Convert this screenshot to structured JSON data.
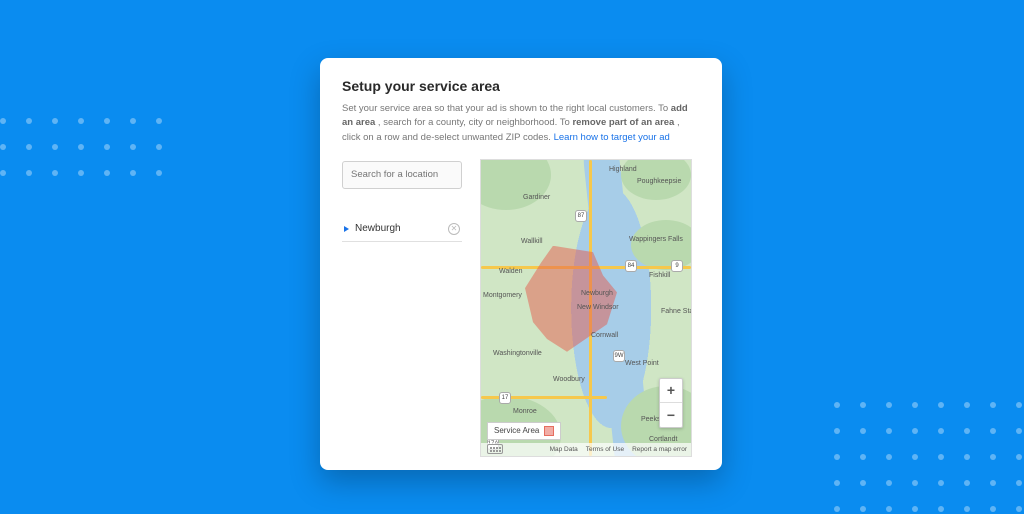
{
  "header": {
    "title": "Setup your service area",
    "desc_pre": "Set your service area so that your ad is shown to the right local customers. To ",
    "desc_bold1": "add an area",
    "desc_mid1": ", search for a county, city or neighborhood. To ",
    "desc_bold2": "remove part of an area",
    "desc_mid2": ", click on a row and de-select unwanted ZIP codes. ",
    "link": "Learn how to target your ad"
  },
  "search": {
    "placeholder": "Search for a location"
  },
  "locations": [
    {
      "name": "Newburgh"
    }
  ],
  "map": {
    "legend_label": "Service Area",
    "attribution": {
      "map_data": "Map Data",
      "terms": "Terms of Use",
      "report": "Report a map error"
    },
    "labels": {
      "highland": "Highland",
      "poughkeepsie": "Poughkeepsie",
      "gardiner": "Gardiner",
      "wallkill": "Wallkill",
      "wappingers": "Wappingers Falls",
      "walden": "Walden",
      "fishkill": "Fishkill",
      "montgomery": "Montgomery",
      "newburgh": "Newburgh",
      "newwindsor": "New Windsor",
      "fahne": "Fahne State",
      "cornwall": "Cornwall",
      "washingtonville": "Washingtonville",
      "westpoint": "West Point",
      "woodbury": "Woodbury",
      "monroe": "Monroe",
      "peekskill": "Peekskill",
      "cortlandt": "Cortlandt"
    },
    "shields": {
      "i84": "84",
      "i87": "87",
      "r17": "17",
      "r9": "9",
      "r9w": "9W",
      "r17a": "17A"
    }
  }
}
